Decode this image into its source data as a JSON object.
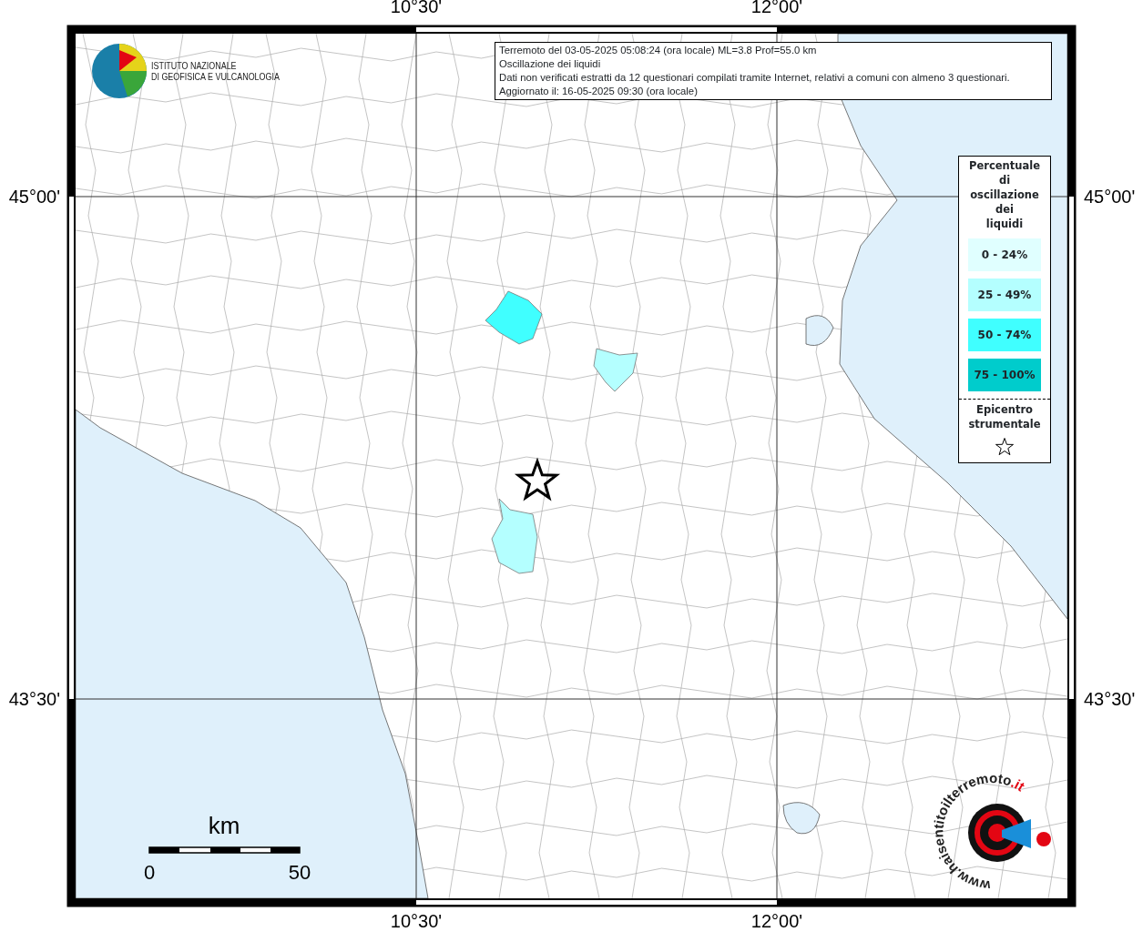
{
  "map": {
    "top_labels": [
      "10°30'",
      "12°00'"
    ],
    "left_labels": [
      "45°00'",
      "43°30'"
    ],
    "right_labels": [
      "45°00'",
      "43°30'"
    ],
    "bottom_labels": [
      "10°30'",
      "12°00'"
    ],
    "felt_areas": [
      {
        "color": "#40ffff"
      },
      {
        "color": "#b4ffff"
      },
      {
        "color": "#b4ffff"
      }
    ]
  },
  "info_box": {
    "lines": [
      "Terremoto del 03-05-2025 05:08:24 (ora locale) ML=3.8 Prof=55.0 km",
      "Oscillazione dei liquidi",
      "Dati non verificati estratti da 12 questionari compilati tramite Internet, relativi a comuni con almeno 3 questionari.",
      "Aggiornato il: 16-05-2025 09:30 (ora locale)"
    ]
  },
  "institute_logo": {
    "lines": [
      "ISTITUTO NAZIONALE",
      "DI GEOFISICA E VULCANOLOGIA"
    ]
  },
  "legend": {
    "title": [
      "Percentuale",
      "di",
      "oscillazione",
      "dei",
      "liquidi"
    ],
    "classes": [
      {
        "label": "0 - 24%",
        "color": "#e0ffff"
      },
      {
        "label": "25 - 49%",
        "color": "#b4ffff"
      },
      {
        "label": "50 - 74%",
        "color": "#40ffff"
      },
      {
        "label": "75 - 100%",
        "color": "#00cccc"
      }
    ],
    "epicenter_label": [
      "Epicentro",
      "strumentale"
    ]
  },
  "scale_bar": {
    "unit": "km",
    "ticks": [
      "0",
      "50"
    ]
  },
  "site_logo": {
    "prefix": "www.",
    "name": "haisentitoilterremoto",
    "suffix": ".it"
  }
}
